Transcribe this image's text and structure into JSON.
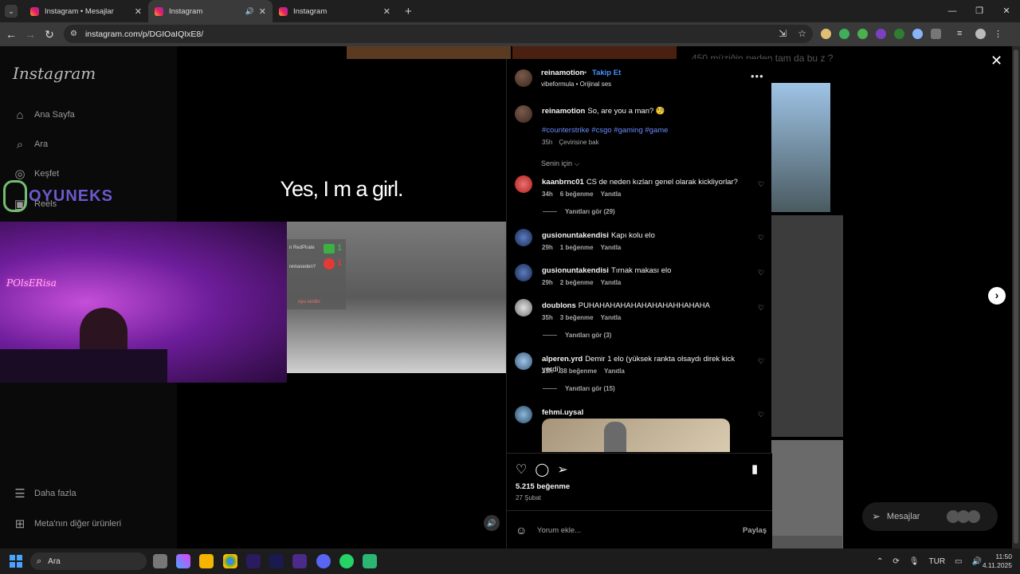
{
  "browser": {
    "tabs": [
      {
        "title": "Instagram • Mesajlar",
        "active": false,
        "audio": false
      },
      {
        "title": "Instagram",
        "active": true,
        "audio": true
      },
      {
        "title": "Instagram",
        "active": false,
        "audio": false
      }
    ],
    "url": "instagram.com/p/DGIOaIQIxE8/"
  },
  "sidebar": {
    "logo": "Instagram",
    "items": [
      {
        "label": "Ana Sayfa",
        "icon": "home-icon"
      },
      {
        "label": "Ara",
        "icon": "search-icon"
      },
      {
        "label": "Keşfet",
        "icon": "compass-icon"
      },
      {
        "label": "Reels",
        "icon": "reels-icon"
      }
    ],
    "bottom": [
      {
        "label": "Daha fazla",
        "icon": "menu-icon"
      },
      {
        "label": "Meta'nın diğer ürünleri",
        "icon": "meta-icon"
      }
    ]
  },
  "video": {
    "caption_overlay": "Yes, I m a girl.",
    "watermark": "OYUNEKS",
    "neon_sign": "POlsERisa",
    "game_panel": {
      "text1": "n RedPirate",
      "text2": "reinaseden?",
      "count_yes": "1",
      "count_no": "1",
      "text3": "oyu verdin"
    }
  },
  "post": {
    "username": "reinamotion",
    "follow_label": "Takip Et",
    "subtitle": "vibeformula • Orijinal ses",
    "caption_user": "reinamotion",
    "caption_text": "So, are you a man? 🧐",
    "hashtags": "#counterstrike #csgo #gaming #game",
    "caption_time": "35h",
    "translate_label": "Çevirisine bak",
    "sort_label": "Senin için ⌵",
    "comments": [
      {
        "user": "kaanbrnc01",
        "text": "CS de neden kızları genel olarak kickliyorlar?",
        "time": "34h",
        "likes": "6 beğenme",
        "reply": "Yanıtla",
        "replies": "Yanıtları gör (29)"
      },
      {
        "user": "gusionuntakendisi",
        "text": "Kapı kolu elo",
        "time": "29h",
        "likes": "1 beğenme",
        "reply": "Yanıtla",
        "replies": ""
      },
      {
        "user": "gusionuntakendisi",
        "text": "Tırnak makası elo",
        "time": "29h",
        "likes": "2 beğenme",
        "reply": "Yanıtla",
        "replies": ""
      },
      {
        "user": "doublons",
        "text": "PUHAHAHAHAHAHAHAHAHHAHAHA",
        "time": "35h",
        "likes": "3 beğenme",
        "reply": "Yanıtla",
        "replies": "Yanıtları gör (3)"
      },
      {
        "user": "alperen.yrd",
        "text": "Demir 1 elo (yüksek rankta olsaydı direk kick yerdi)",
        "time": "35h",
        "likes": "38 beğenme",
        "reply": "Yanıtla",
        "replies": "Yanıtları gör (15)"
      },
      {
        "user": "fehmi.uysal",
        "text": "",
        "time": "",
        "likes": "",
        "reply": "",
        "replies": ""
      }
    ],
    "likes_count": "5.215 beğenme",
    "date": "27 Şubat",
    "comment_placeholder": "Yorum ekle...",
    "post_label": "Paylaş"
  },
  "background": {
    "text": "450 müziğin neden tam da bu z ?",
    "messages_label": "Mesajlar"
  },
  "taskbar": {
    "search_label": "Ara",
    "lang": "TUR",
    "time": "11:50",
    "date": "4.11.2025"
  },
  "colors": {
    "accent_blue": "#4a90ff",
    "hashtag": "#6b8cff"
  }
}
